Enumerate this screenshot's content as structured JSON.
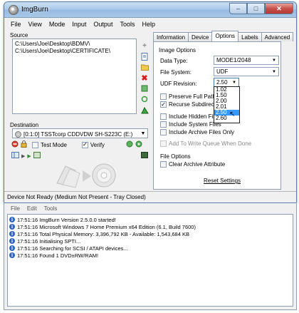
{
  "window": {
    "title": "ImgBurn"
  },
  "menu": [
    "File",
    "View",
    "Mode",
    "Input",
    "Output",
    "Tools",
    "Help"
  ],
  "source": {
    "label": "Source",
    "items": [
      "C:\\Users\\Joe\\Desktop\\BDMV\\",
      "C:\\Users\\Joe\\Desktop\\CERTIFICATE\\"
    ]
  },
  "destination": {
    "label": "Destination",
    "drive": "[0:1:0] TSSTcorp CDDVDW SH-S223C (E:)",
    "test_mode_label": "Test Mode",
    "verify_label": "Verify",
    "test_mode": false,
    "verify": true
  },
  "tabs": [
    "Information",
    "Device",
    "Options",
    "Labels",
    "Advanced"
  ],
  "active_tab": "Options",
  "options": {
    "image_options_label": "Image Options",
    "data_type_label": "Data Type:",
    "data_type_value": "MODE1/2048",
    "file_system_label": "File System:",
    "file_system_value": "UDF",
    "udf_revision_label": "UDF Revision:",
    "udf_revision_value": "2.50",
    "udf_options": [
      "1.02",
      "1.50",
      "2.00",
      "2.01",
      "2.50",
      "2.60"
    ],
    "udf_selected": "2.50",
    "checkboxes": [
      {
        "label": "Preserve Full Pathn",
        "checked": false,
        "enabled": true
      },
      {
        "label": "Recurse Subdirecto",
        "checked": true,
        "enabled": true
      },
      {
        "label": "Include Hidden File",
        "checked": false,
        "enabled": true
      },
      {
        "label": "Include System Files",
        "checked": false,
        "enabled": true
      },
      {
        "label": "Include Archive Files Only",
        "checked": false,
        "enabled": true
      },
      {
        "label": "Add To Write Queue When Done",
        "checked": false,
        "enabled": false
      }
    ],
    "file_options_label": "File Options",
    "clear_archive_label": "Clear Archive Attribute",
    "reset_settings_label": "Reset Settings"
  },
  "status": "Device Not Ready (Medium Not Present - Tray Closed)",
  "log": {
    "menu": [
      "File",
      "Edit",
      "Tools"
    ],
    "lines": [
      "17:51:16 ImgBurn Version 2.5.0.0 started!",
      "17:51:16 Microsoft Windows 7 Home Premium x64 Edition (6.1, Build 7600)",
      "17:51:16 Total Physical Memory: 3,396,792 KB  -  Available: 1,543,684 KB",
      "17:51:16 Initialising SPTI...",
      "17:51:16 Searching for SCSI / ATAPI devices...",
      "17:51:16 Found 1 DVD±RW/RAM!"
    ]
  }
}
